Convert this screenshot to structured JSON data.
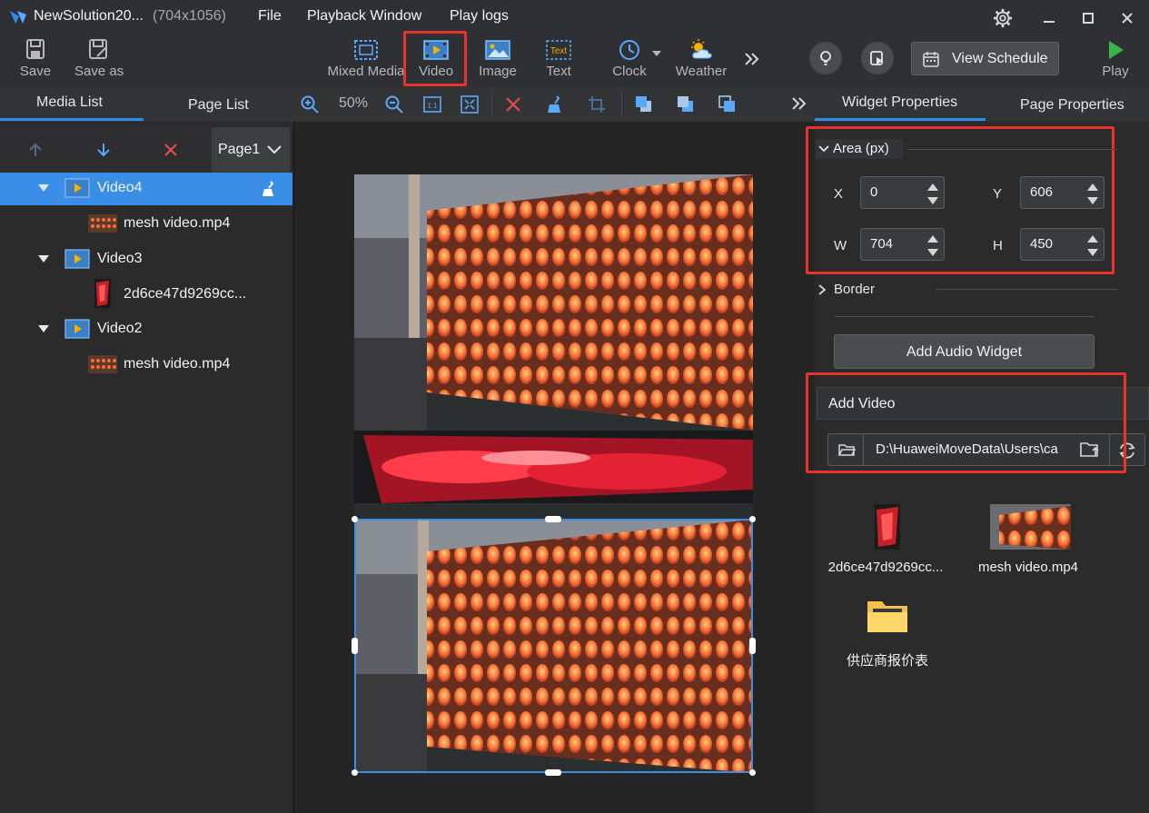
{
  "titlebar": {
    "app_title": "NewSolution20...",
    "resolution": "(704x1056)",
    "menu": [
      "File",
      "Playback Window",
      "Play logs"
    ]
  },
  "toolbar": {
    "save": "Save",
    "save_as": "Save as",
    "mixed_media": "Mixed Media",
    "video": "Video",
    "image": "Image",
    "text": "Text",
    "text_icon_label": "Text",
    "clock": "Clock",
    "weather": "Weather",
    "view_schedule": "View Schedule",
    "play": "Play"
  },
  "left_panel": {
    "tabs": [
      "Media List",
      "Page List"
    ],
    "page_select": "Page1",
    "tree": [
      {
        "label": "Video4",
        "selected": true,
        "child": "mesh video.mp4"
      },
      {
        "label": "Video3",
        "selected": false,
        "child": "2d6ce47d9269cc..."
      },
      {
        "label": "Video2",
        "selected": false,
        "child": "mesh video.mp4"
      }
    ]
  },
  "canvas_toolbar": {
    "zoom": "50%"
  },
  "right_panel": {
    "tabs": [
      "Widget Properties",
      "Page Properties"
    ],
    "area": {
      "title": "Area (px)",
      "x_label": "X",
      "x": "0",
      "y_label": "Y",
      "y": "606",
      "w_label": "W",
      "w": "704",
      "h_label": "H",
      "h": "450"
    },
    "border_label": "Border",
    "add_audio": "Add Audio Widget",
    "add_video": "Add Video",
    "path": "D:\\HuaweiMoveData\\Users\\ca",
    "files": [
      "2d6ce47d9269cc...",
      "mesh video.mp4",
      "供应商报价表"
    ]
  },
  "colors": {
    "accent_blue": "#2d8cf0",
    "highlight_red": "#e8322e",
    "play_green": "#3bb54a"
  }
}
